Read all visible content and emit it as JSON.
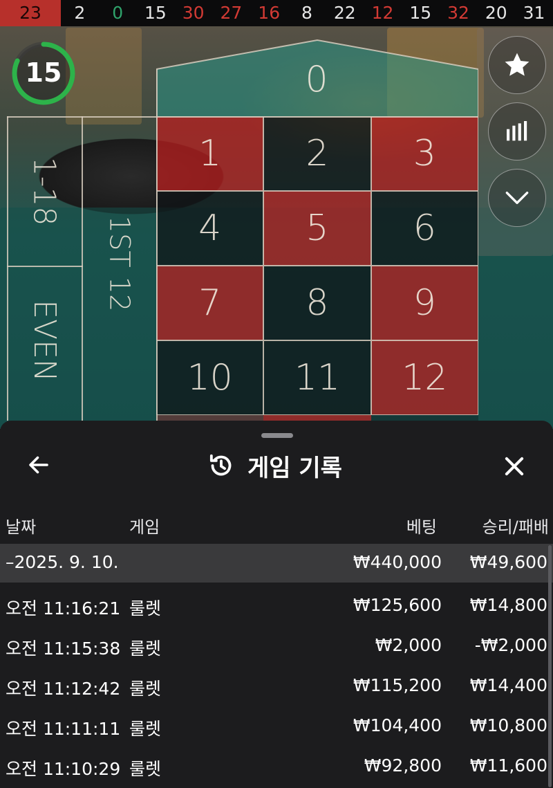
{
  "results_strip": [
    {
      "value": "23",
      "color": "red"
    },
    {
      "value": "2",
      "color": "black"
    },
    {
      "value": "0",
      "color": "green"
    },
    {
      "value": "15",
      "color": "black"
    },
    {
      "value": "30",
      "color": "red"
    },
    {
      "value": "27",
      "color": "red"
    },
    {
      "value": "16",
      "color": "red"
    },
    {
      "value": "8",
      "color": "black"
    },
    {
      "value": "22",
      "color": "black"
    },
    {
      "value": "12",
      "color": "red"
    },
    {
      "value": "15",
      "color": "black"
    },
    {
      "value": "32",
      "color": "red"
    },
    {
      "value": "20",
      "color": "black"
    },
    {
      "value": "31",
      "color": "black"
    }
  ],
  "timer": {
    "seconds": "15",
    "progress": 0.82,
    "color": "#2db34a"
  },
  "board": {
    "zero": "0",
    "numbers": [
      {
        "n": "1",
        "color": "red"
      },
      {
        "n": "2",
        "color": "black"
      },
      {
        "n": "3",
        "color": "red"
      },
      {
        "n": "4",
        "color": "black"
      },
      {
        "n": "5",
        "color": "red"
      },
      {
        "n": "6",
        "color": "black"
      },
      {
        "n": "7",
        "color": "red"
      },
      {
        "n": "8",
        "color": "black"
      },
      {
        "n": "9",
        "color": "red"
      },
      {
        "n": "10",
        "color": "black"
      },
      {
        "n": "11",
        "color": "black"
      },
      {
        "n": "12",
        "color": "red"
      }
    ],
    "outside_low": "1-18",
    "outside_even": "EVEN",
    "dozen": "1ST 12"
  },
  "side_buttons": [
    {
      "icon": "star-icon"
    },
    {
      "icon": "statistics-icon"
    },
    {
      "icon": "chevron-down-icon"
    }
  ],
  "panel": {
    "title": "게임 기록",
    "back_icon": "arrow-left-icon",
    "history_icon": "history-icon",
    "close_icon": "close-icon",
    "columns": {
      "date": "날짜",
      "game": "게임",
      "bet": "베팅",
      "result": "승리/패배"
    },
    "date_group": {
      "label": "–2025. 9. 10.",
      "bet": "₩440,000",
      "result": "₩49,600"
    },
    "rows": [
      {
        "time": "오전 11:16:21",
        "game": "룰렛",
        "bet": "₩125,600",
        "result": "₩14,800"
      },
      {
        "time": "오전 11:15:38",
        "game": "룰렛",
        "bet": "₩2,000",
        "result": "-₩2,000"
      },
      {
        "time": "오전 11:12:42",
        "game": "룰렛",
        "bet": "₩115,200",
        "result": "₩14,400"
      },
      {
        "time": "오전 11:11:11",
        "game": "룰렛",
        "bet": "₩104,400",
        "result": "₩10,800"
      },
      {
        "time": "오전 11:10:29",
        "game": "룰렛",
        "bet": "₩92,800",
        "result": "₩11,600"
      }
    ]
  }
}
